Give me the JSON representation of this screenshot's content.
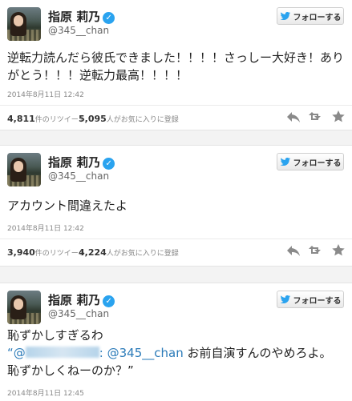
{
  "tweets": [
    {
      "name": "指原 莉乃",
      "verified_mark": "✓",
      "handle": "@345__chan",
      "follow_label": "フォローする",
      "text": "逆転力読んだら彼氏できました！！！！さっしー大好き！ありがとう！！！逆転力最高！！！！",
      "timestamp": "2014年8月11日 12:42",
      "retweets_count": "4,811",
      "retweets_label": "件のリツイート",
      "favorites_count": "5,095",
      "favorites_label": "人がお気に入りに登録"
    },
    {
      "name": "指原 莉乃",
      "verified_mark": "✓",
      "handle": "@345__chan",
      "follow_label": "フォローする",
      "text": "アカウント間違えたよ",
      "timestamp": "2014年8月11日 12:42",
      "retweets_count": "3,940",
      "retweets_label": "件のリツイート",
      "favorites_count": "4,224",
      "favorites_label": "人がお気に入りに登録"
    },
    {
      "name": "指原 莉乃",
      "verified_mark": "✓",
      "handle": "@345__chan",
      "follow_label": "フォローする",
      "text_line1": "恥ずかしすぎるわ",
      "quote_open": "“@",
      "mention_tail": ":",
      "mention": "@345__chan",
      "quote_text": " お前自演すんのやめろよ。",
      "text_line3": "恥ずかしくねーのか？”",
      "timestamp": "2014年8月11日 12:45"
    }
  ],
  "icons": [
    "verified-badge-icon",
    "twitter-bird-icon",
    "reply-icon",
    "retweet-icon",
    "favorite-star-icon"
  ],
  "colors": {
    "link": "#2b7bb9",
    "verified": "#2aa3ef",
    "bird": "#2aa3ef",
    "muted": "#888888"
  }
}
